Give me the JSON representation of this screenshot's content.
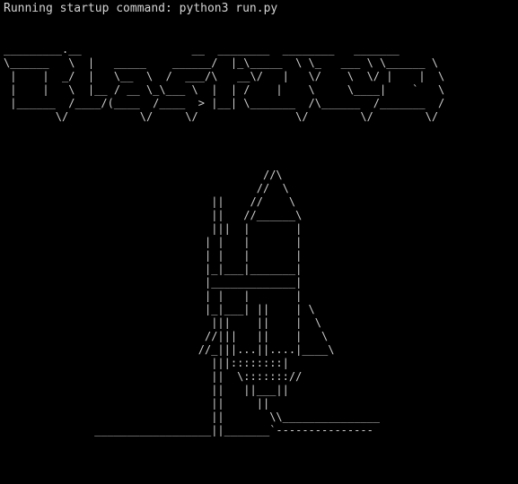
{
  "terminal": {
    "background": "#000000",
    "foreground": "#d4d4d4",
    "startup_line": "Running startup command: python3 run.py",
    "banner_art": "_________.__                 __  ________  ________   _______\n\\______   \\  |   _____    ______/  |_\\_____  \\ \\_   ___ \\ \\______ \\\n |    |  _/  |   \\__  \\  /  ___/\\   __\\/   |   \\/    \\  \\/ |    |  \\\n |    |   \\  |__ / __ \\_\\___ \\  |  | /    |    \\     \\____|    `   \\\n |______  /____/(____  /____  > |__| \\_______  /\\______  /_______  /\n        \\/           \\/     \\/               \\/        \\/        \\/",
    "rocket_art": "                                        //\\\n                                       //  \\\n                                ||    //    \\\n                                ||   //______\\\n                                |||  |       |\n                               | |   |       |\n                               | |   |       |\n                               |_|___|_______|\n                               |_____________|\n                               | |   |       |\n                               |_|___| ||    | \\\n                                |||    ||    |  \\\n                               //|||   ||    |   \\\n                              //_|||...||....|____\\\n                                |||::::::::|\n                                ||  \\::::::://\n                                ||   ||___||\n                                ||     ||\n                                ||       \\\\_______________\n              __________________||_______`---------------"
  }
}
